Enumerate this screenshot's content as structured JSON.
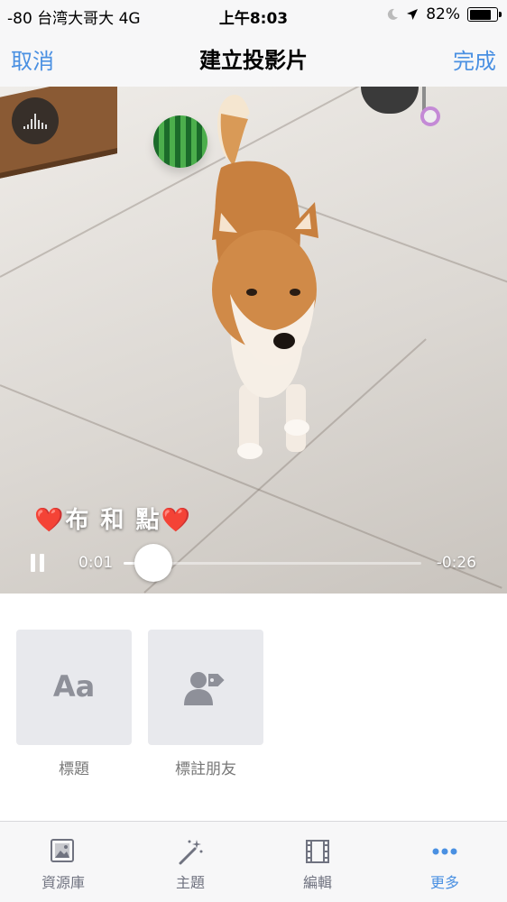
{
  "status_bar": {
    "carrier": "-80 台湾大哥大   4G",
    "time": "上午8:03",
    "battery_percent": "82%",
    "battery_level": 0.82
  },
  "nav": {
    "cancel_label": "取消",
    "title": "建立投影片",
    "done_label": "完成"
  },
  "player": {
    "caption": "布 和 點",
    "time_elapsed": "0:01",
    "time_remaining": "-0:26",
    "progress": 0.1
  },
  "tiles": [
    {
      "icon": "text-aa",
      "glyph": "Aa",
      "label": "標題"
    },
    {
      "icon": "tag-person-icon",
      "label": "標註朋友"
    }
  ],
  "tab_bar": {
    "items": [
      {
        "icon": "photo-library-icon",
        "label": "資源庫"
      },
      {
        "icon": "magic-wand-icon",
        "label": "主題"
      },
      {
        "icon": "film-strip-icon",
        "label": "編輯"
      },
      {
        "icon": "more-dots-icon",
        "label": "更多"
      }
    ],
    "active_color": "#4a90e2",
    "inactive_color": "#707380"
  },
  "colors": {
    "accent": "#4a90e2",
    "tile_bg": "#e8e9ed"
  }
}
